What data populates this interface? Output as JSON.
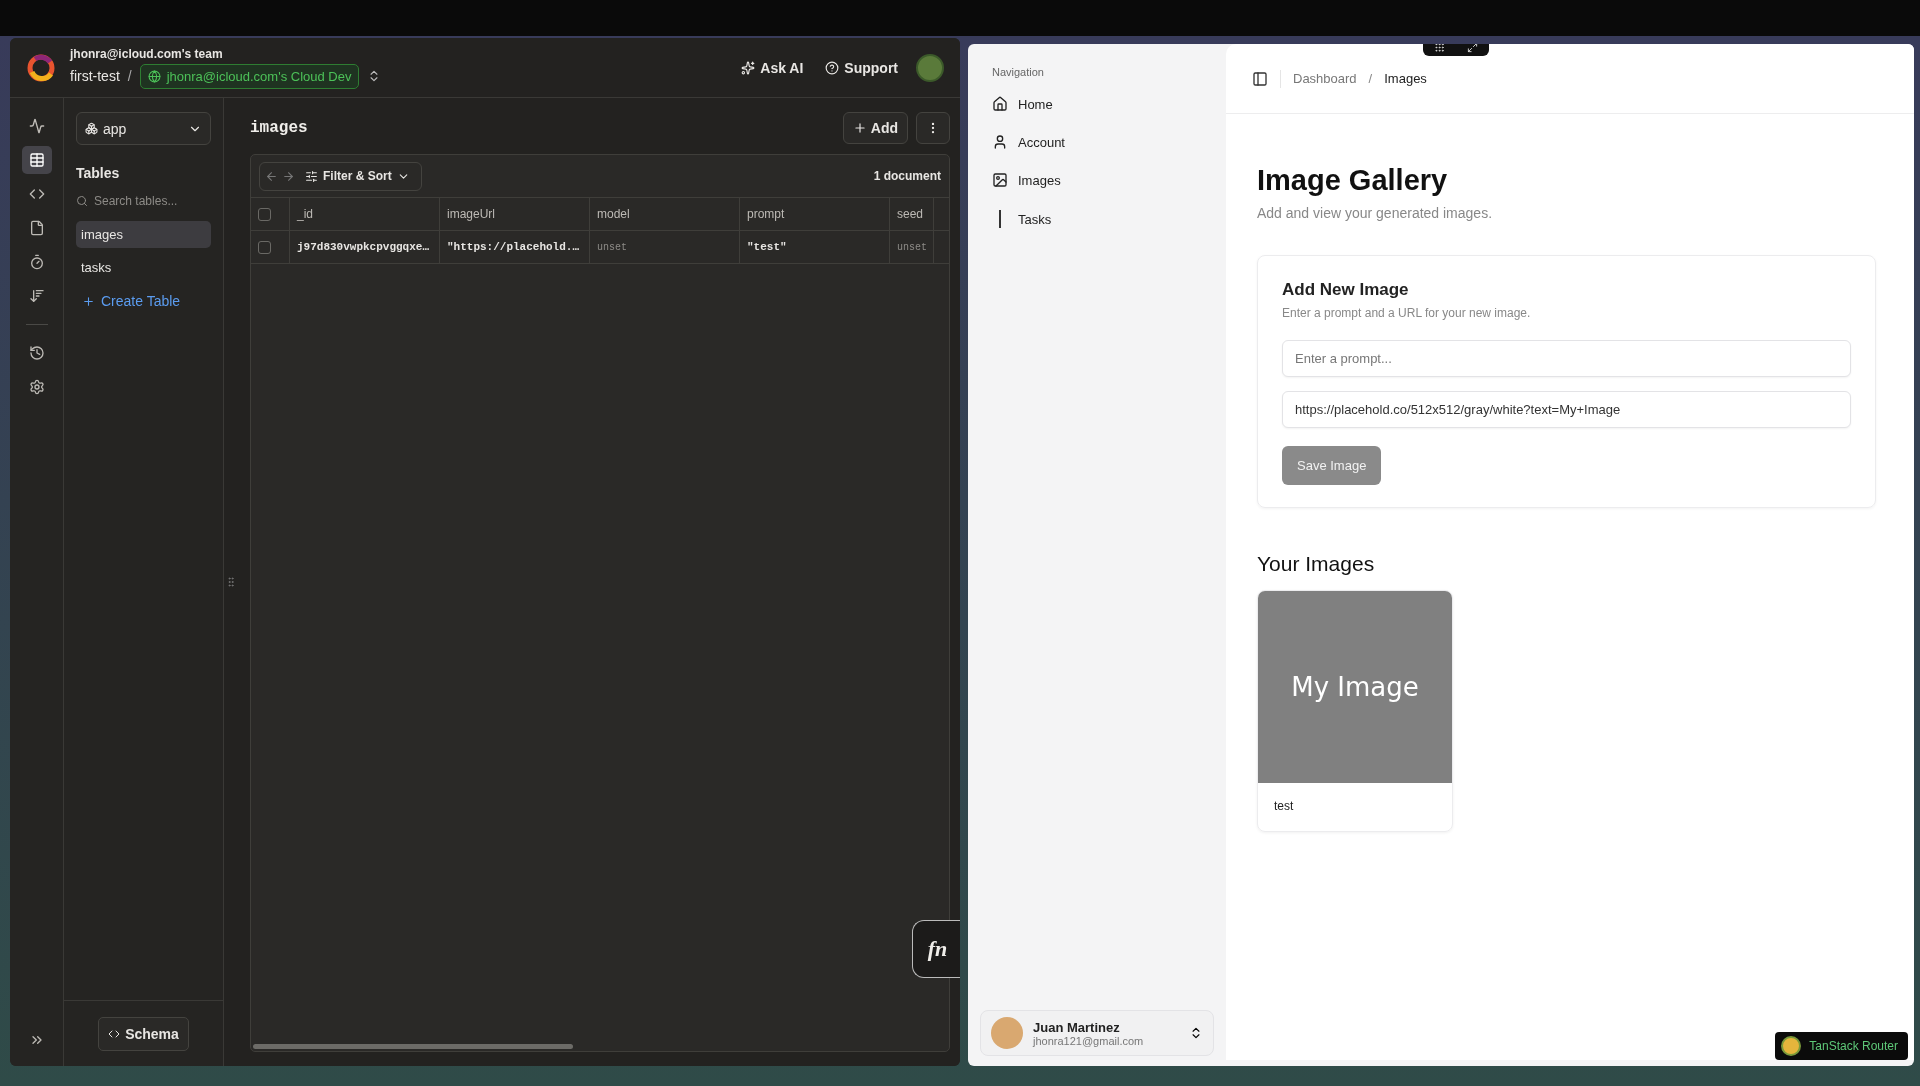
{
  "dashboard": {
    "header": {
      "team": "jhonra@icloud.com's team",
      "project": "first-test",
      "separator": "/",
      "deployment": "jhonra@icloud.com's Cloud Dev",
      "actions": [
        {
          "kind": "sparkle",
          "label": "Ask AI"
        },
        {
          "kind": "help",
          "label": "Support"
        }
      ]
    },
    "rail": [
      {
        "kind": "activity",
        "selected": false
      },
      {
        "kind": "table",
        "selected": true
      },
      {
        "kind": "code",
        "selected": false
      },
      {
        "kind": "file",
        "selected": false
      },
      {
        "kind": "timer",
        "selected": false
      },
      {
        "kind": "list",
        "selected": false
      },
      {
        "kind": "divider"
      },
      {
        "kind": "history",
        "selected": false
      },
      {
        "kind": "settings",
        "selected": false
      }
    ],
    "component_select": "app",
    "tables_title": "Tables",
    "search": {
      "placeholder": "Search tables..."
    },
    "tables": [
      {
        "label": "images",
        "selected": true
      },
      {
        "label": "tasks",
        "selected": false
      }
    ],
    "create_table": "Create Table",
    "schema_button": "Schema",
    "table_name": "images",
    "add_button": "Add",
    "filter_button": "Filter & Sort",
    "document_count": "1 document",
    "all_checked": false,
    "columns": [
      "_id",
      "imageUrl",
      "model",
      "prompt",
      "seed"
    ],
    "rows": [
      {
        "checked": false,
        "cells": [
          {
            "kind": "id",
            "text": "j97d830vwpkcpvggqxe…"
          },
          {
            "kind": "value",
            "text": "\"https://placehold.…"
          },
          {
            "kind": "unset",
            "text": "unset"
          },
          {
            "kind": "value",
            "text": "\"test\""
          },
          {
            "kind": "unset",
            "text": "unset"
          }
        ]
      }
    ],
    "fn_button": "fn"
  },
  "app": {
    "nav_title": "Navigation",
    "nav": [
      {
        "kind": "home",
        "label": "Home"
      },
      {
        "kind": "user",
        "label": "Account"
      },
      {
        "kind": "image",
        "label": "Images"
      },
      {
        "kind": "line",
        "label": "Tasks"
      }
    ],
    "user": {
      "name": "Juan Martinez",
      "email": "jhonra121@gmail.com"
    },
    "breadcrumb": [
      {
        "label": "Dashboard",
        "current": false
      },
      {
        "label": "Images",
        "current": true
      }
    ],
    "breadcrumb_separator": "/",
    "title": "Image Gallery",
    "subtitle": "Add and view your generated images.",
    "form": {
      "title": "Add New Image",
      "description": "Enter a prompt and a URL for your new image.",
      "prompt": {
        "placeholder": "Enter a prompt..."
      },
      "url": {
        "value": "https://placehold.co/512x512/gray/white?text=My+Image"
      },
      "button": "Save Image"
    },
    "gallery_title": "Your Images",
    "images": [
      {
        "image_text": "My Image",
        "caption": "test"
      }
    ],
    "router_badge": "TanStack Router"
  }
}
